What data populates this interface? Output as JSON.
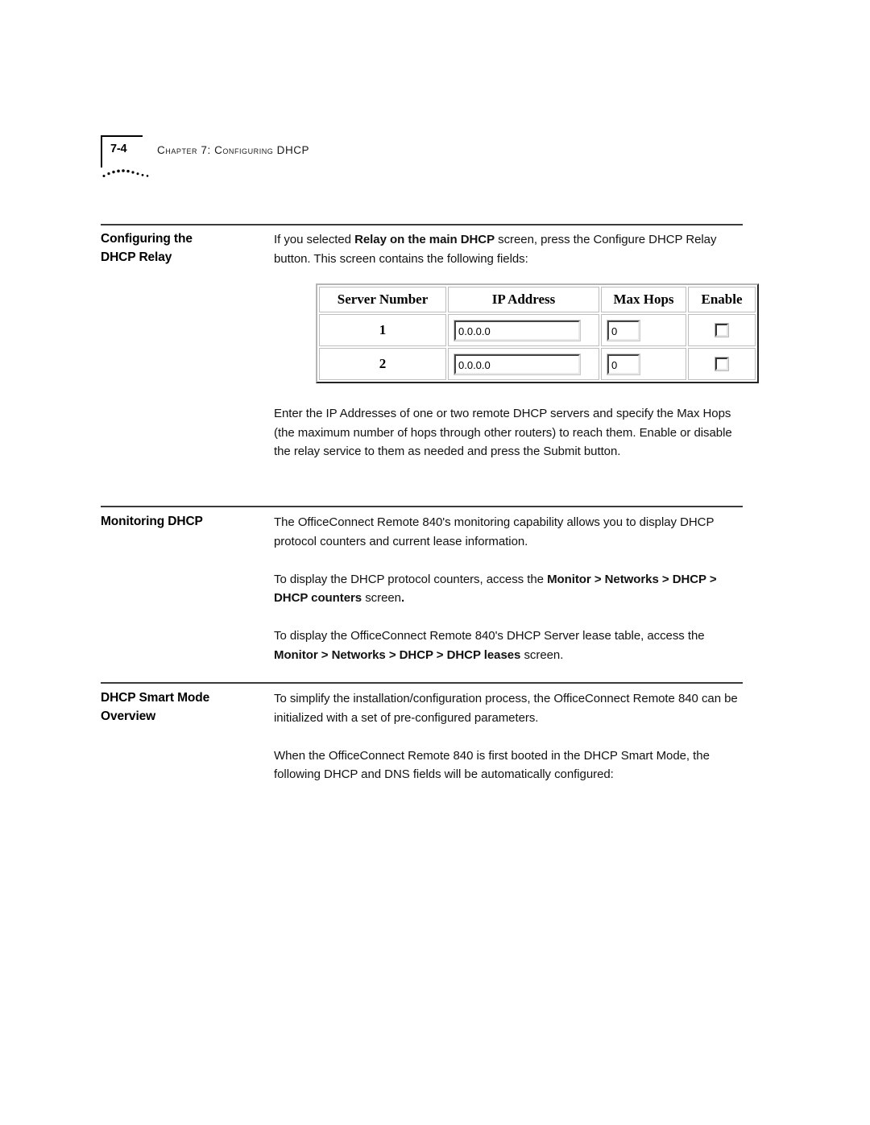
{
  "page": {
    "folio": "7-4",
    "chapter_title": "Chapter 7: Configuring DHCP"
  },
  "sections": [
    {
      "heading_line1": "Configuring the",
      "heading_line2": "DHCP Relay",
      "paragraphs": [
        {
          "runs": [
            {
              "text": "If you selected ",
              "bold": false
            },
            {
              "text": "Relay on the main DHCP",
              "bold": true
            },
            {
              "text": " screen, press the Configure DHCP Relay button. This screen contains the following fields:",
              "bold": false
            }
          ]
        }
      ]
    },
    {
      "heading_line1": "Monitoring DHCP",
      "heading_line2": "",
      "paragraphs": [
        {
          "runs": [
            {
              "text": "The OfficeConnect Remote 840's monitoring capability allows you to display DHCP protocol counters and current lease information.",
              "bold": false
            }
          ]
        },
        {
          "runs": [
            {
              "text": "To display the DHCP protocol counters, access the ",
              "bold": false
            },
            {
              "text": "Monitor > Networks > DHCP > DHCP counters",
              "bold": true
            },
            {
              "text": " screen",
              "bold": false
            },
            {
              "text": ".",
              "bold": true
            }
          ]
        },
        {
          "runs": [
            {
              "text": "To display the OfficeConnect Remote 840's DHCP Server lease table, access the ",
              "bold": false
            },
            {
              "text": "Monitor > Networks > DHCP > DHCP leases",
              "bold": true
            },
            {
              "text": " screen.",
              "bold": false
            }
          ]
        }
      ]
    },
    {
      "heading_line1": "DHCP Smart Mode",
      "heading_line2": "Overview",
      "paragraphs": [
        {
          "runs": [
            {
              "text": "To simplify the installation/configuration process, the OfficeConnect Remote 840 can be initialized with a set of pre-configured parameters.",
              "bold": false
            }
          ]
        },
        {
          "runs": [
            {
              "text": "When the OfficeConnect Remote 840 is first booted in the DHCP Smart Mode, the following DHCP and DNS fields will be automatically configured:",
              "bold": false
            }
          ]
        }
      ]
    }
  ],
  "relay_table": {
    "headers": [
      "Server Number",
      "IP Address",
      "Max Hops",
      "Enable"
    ],
    "rows": [
      {
        "server_number": "1",
        "ip_address": "0.0.0.0",
        "max_hops": "0",
        "enable": false
      },
      {
        "server_number": "2",
        "ip_address": "0.0.0.0",
        "max_hops": "0",
        "enable": false
      }
    ]
  }
}
